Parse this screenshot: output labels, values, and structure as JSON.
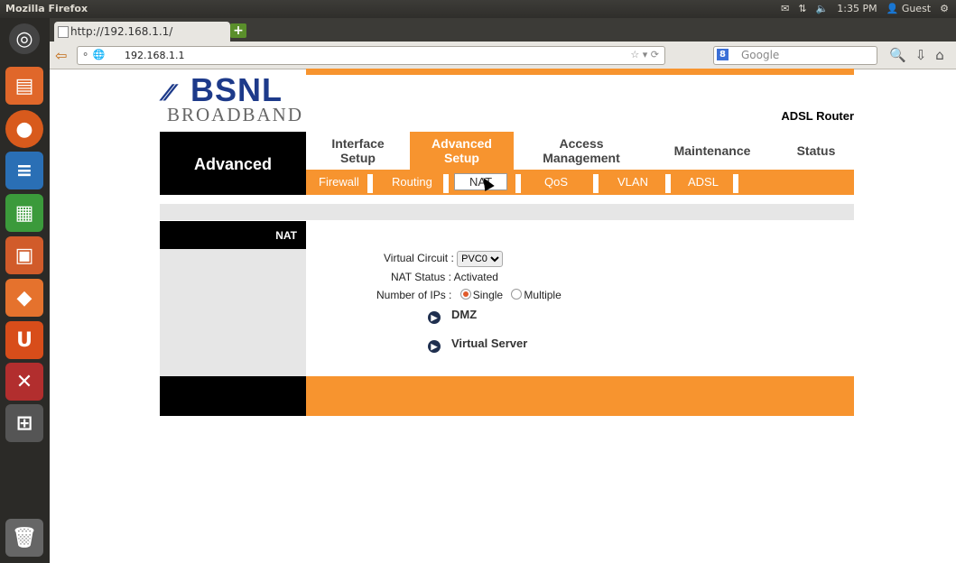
{
  "system": {
    "window_title": "Mozilla Firefox",
    "clock": "1:35 PM",
    "user": "Guest"
  },
  "browser": {
    "tab_title": "http://192.168.1.1/",
    "new_tab_label": "+",
    "url": "192.168.1.1",
    "search_engine_label": "8",
    "search_placeholder": "Google"
  },
  "launcher": {
    "items": [
      "dash-home",
      "files",
      "firefox",
      "writer",
      "calc",
      "impress",
      "software-center",
      "ubuntu-one",
      "system-settings",
      "workspaces",
      "trash"
    ]
  },
  "router": {
    "logo_text": "BSNL",
    "logo_subtext": "BROADBAND",
    "device_label": "ADSL Router",
    "section_title": "Advanced",
    "main_nav": [
      {
        "label": "Interface\nSetup",
        "active": false
      },
      {
        "label": "Advanced\nSetup",
        "active": true
      },
      {
        "label": "Access\nManagement",
        "active": false
      },
      {
        "label": "Maintenance",
        "active": false
      },
      {
        "label": "Status",
        "active": false
      }
    ],
    "sub_nav": [
      {
        "label": "Firewall",
        "active": false
      },
      {
        "label": "Routing",
        "active": false
      },
      {
        "label": "NAT",
        "active": true
      },
      {
        "label": "QoS",
        "active": false
      },
      {
        "label": "VLAN",
        "active": false
      },
      {
        "label": "ADSL",
        "active": false
      }
    ],
    "page_label": "NAT",
    "form": {
      "virtual_circuit_label": "Virtual Circuit :",
      "virtual_circuit_value": "PVC0",
      "nat_status_label": "NAT Status :",
      "nat_status_value": "Activated",
      "num_ips_label": "Number of IPs :",
      "num_ips_options": [
        "Single",
        "Multiple"
      ],
      "num_ips_selected": "Single"
    },
    "links": [
      "DMZ",
      "Virtual Server"
    ],
    "colors": {
      "accent": "#f7942f",
      "black": "#000000",
      "brand_blue": "#1d3a8a"
    }
  }
}
